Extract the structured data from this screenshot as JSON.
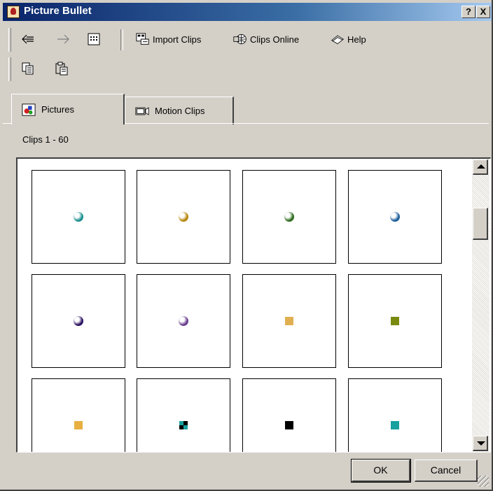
{
  "window": {
    "title": "Picture Bullet",
    "help_btn": "?",
    "close_btn": "X"
  },
  "toolbar": {
    "import_label": "Import Clips",
    "online_label": "Clips Online",
    "help_label": "Help"
  },
  "tabs": [
    {
      "label": "Pictures",
      "icon": "pictures-icon",
      "active": true
    },
    {
      "label": "Motion Clips",
      "icon": "motion-clips-icon",
      "active": false
    }
  ],
  "clips_range": "Clips 1 - 60",
  "clips": [
    {
      "shape": "ball",
      "color": "#1c8f90"
    },
    {
      "shape": "ball",
      "color": "#b8860b"
    },
    {
      "shape": "ball",
      "color": "#2e6b1e"
    },
    {
      "shape": "ball",
      "color": "#1f5f9a"
    },
    {
      "shape": "ball",
      "color": "#2a1060"
    },
    {
      "shape": "ball",
      "color": "#6a3f8f"
    },
    {
      "shape": "square",
      "color": "#e0b050"
    },
    {
      "shape": "square",
      "color": "#7a8a10"
    },
    {
      "shape": "square",
      "color": "#e8b040"
    },
    {
      "shape": "checker",
      "color": "#17a0a0"
    },
    {
      "shape": "square",
      "color": "#000000"
    },
    {
      "shape": "square",
      "color": "#17a0a0"
    }
  ],
  "buttons": {
    "ok": "OK",
    "cancel": "Cancel"
  }
}
